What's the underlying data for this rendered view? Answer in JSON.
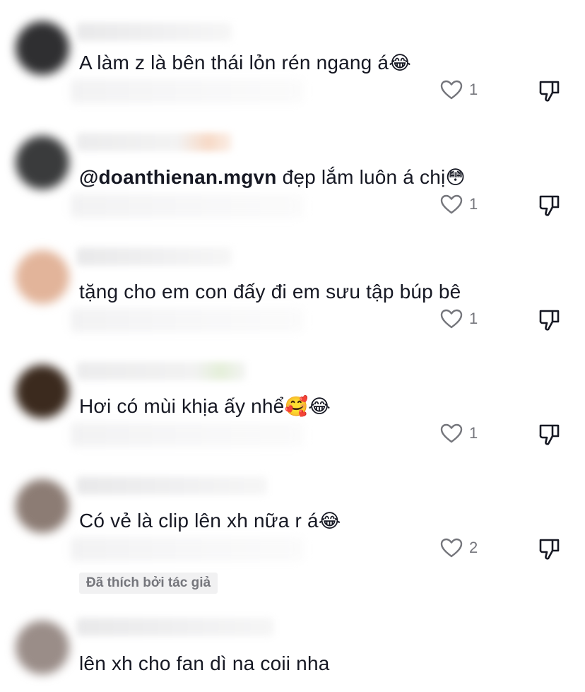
{
  "comments": [
    {
      "text": "A làm z là bên thái lỏn rén ngang á",
      "emoji": "😂",
      "likes": "1"
    },
    {
      "mention": "@doanthienan.mgvn",
      "text": " đẹp lắm luôn á chị",
      "emoji": "😳",
      "likes": "1"
    },
    {
      "text": "tặng cho em con đấy đi em sưu tập búp bê",
      "emoji": "",
      "likes": "1"
    },
    {
      "text": "Hơi có mùi khịa ấy nhể",
      "emoji": "🥰😂",
      "likes": "1"
    },
    {
      "text": "Có vẻ là clip lên xh nữa r á",
      "emoji": "😂",
      "likes": "2",
      "badge": "Đã thích bởi tác giả"
    },
    {
      "text": "lên xh cho fan dì na coii nha",
      "emoji": ""
    }
  ],
  "colors": {
    "text": "#161823",
    "muted": "#75767c",
    "badge_bg": "#f1f1f2"
  },
  "icons": {
    "like": "heart-outline-icon",
    "dislike": "thumbs-down-icon"
  }
}
